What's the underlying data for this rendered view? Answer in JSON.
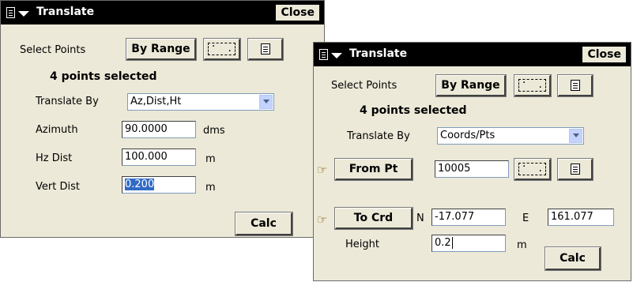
{
  "dialog_left": {
    "title": "Translate",
    "close_label": "Close",
    "select_points_label": "Select Points",
    "by_range_label": "By Range",
    "points_selected": "4 points selected",
    "translate_by_label": "Translate By",
    "translate_by_value": "Az,Dist,Ht",
    "azimuth_label": "Azimuth",
    "azimuth_value": "90.0000",
    "azimuth_unit": "dms",
    "hz_dist_label": "Hz Dist",
    "hz_dist_value": "100.000",
    "hz_dist_unit": "m",
    "vert_dist_label": "Vert Dist",
    "vert_dist_value": "0.200",
    "vert_dist_unit": "m",
    "calc_label": "Calc"
  },
  "dialog_right": {
    "title": "Translate",
    "close_label": "Close",
    "select_points_label": "Select Points",
    "by_range_label": "By Range",
    "points_selected": "4 points selected",
    "translate_by_label": "Translate By",
    "translate_by_value": "Coords/Pts",
    "from_pt_label": "From Pt",
    "from_pt_value": "10005",
    "to_crd_label": "To Crd",
    "n_label": "N",
    "n_value": "-17.077",
    "e_label": "E",
    "e_value": "161.077",
    "height_label": "Height",
    "height_value": "0.2",
    "height_unit": "m",
    "calc_label": "Calc"
  },
  "icons": {
    "menu": "document-menu-icon",
    "range": "range-select-icon",
    "list": "point-list-icon",
    "pointer": "pointing-hand-icon"
  }
}
